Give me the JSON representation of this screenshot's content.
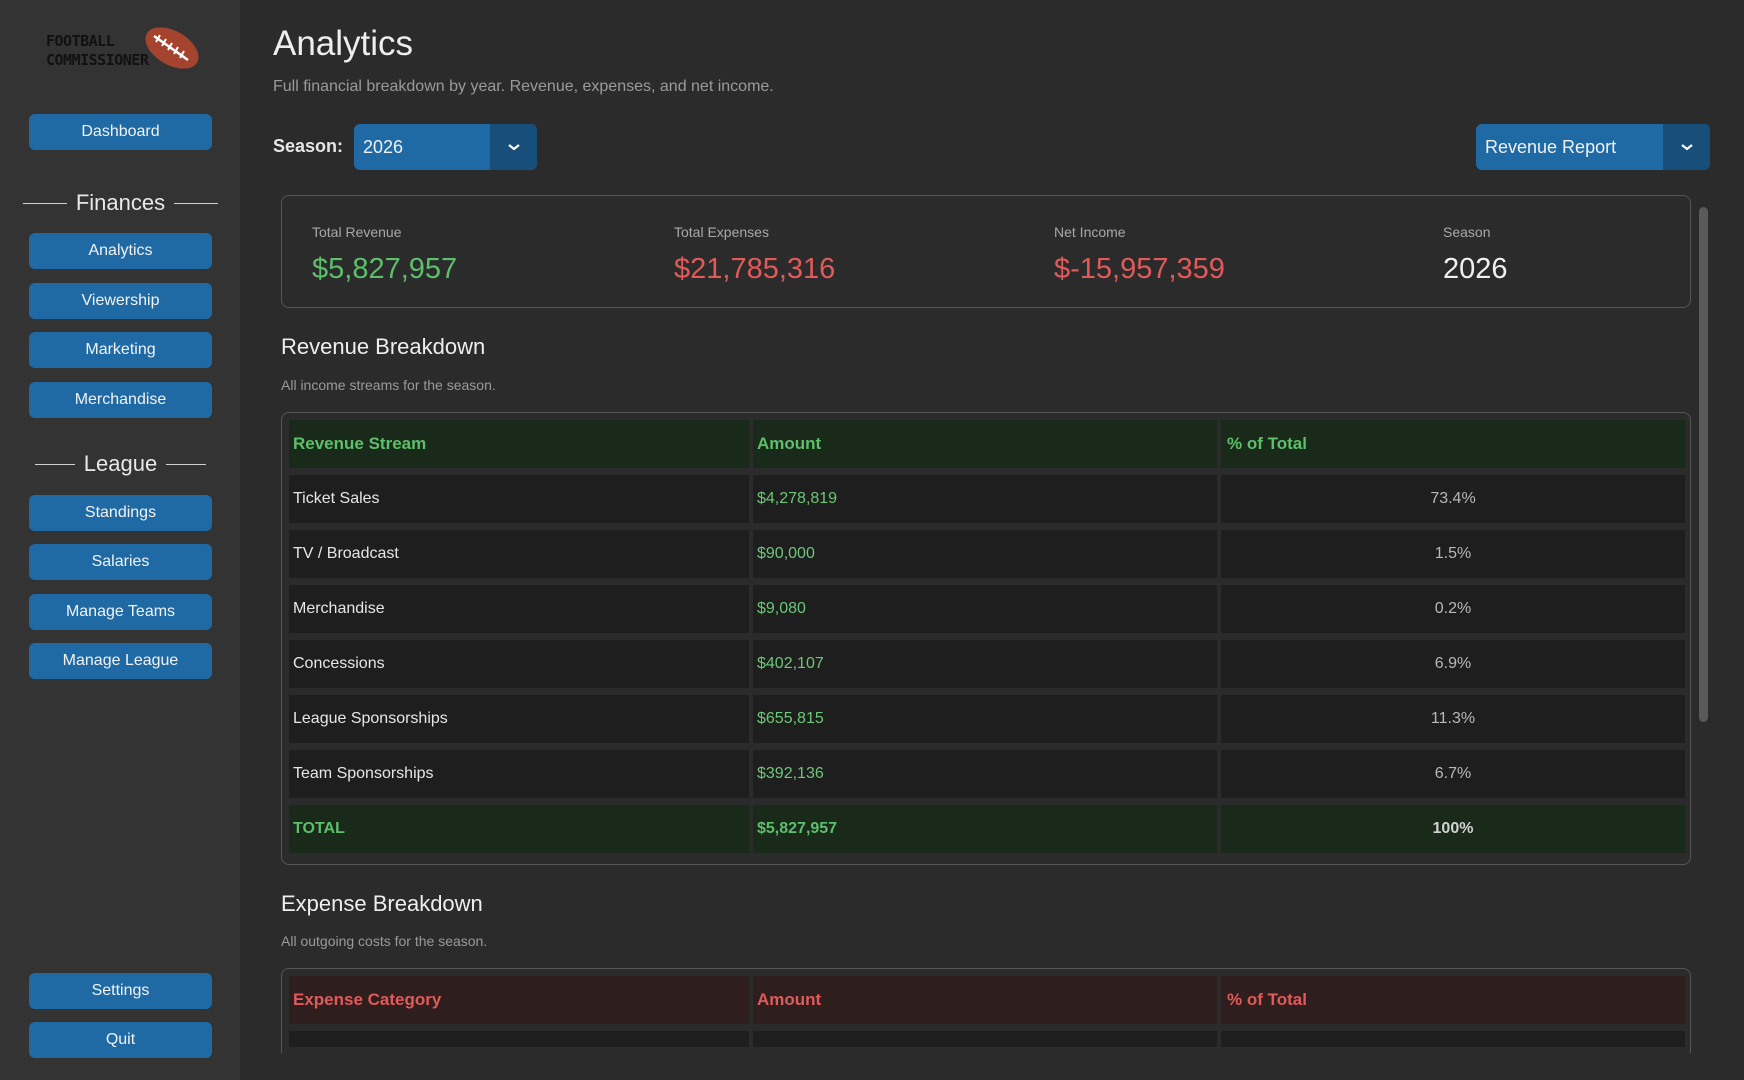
{
  "logo": {
    "line1": "FOOTBALL",
    "line2": "COMMISSIONER"
  },
  "nav": {
    "dashboard": "Dashboard",
    "finances_heading": "Finances",
    "analytics": "Analytics",
    "viewership": "Viewership",
    "marketing": "Marketing",
    "merchandise": "Merchandise",
    "league_heading": "League",
    "standings": "Standings",
    "salaries": "Salaries",
    "manage_teams": "Manage Teams",
    "manage_league": "Manage League",
    "settings": "Settings",
    "quit": "Quit"
  },
  "header": {
    "title": "Analytics",
    "subtitle": "Full financial breakdown by year. Revenue, expenses, and net income.",
    "season_label": "Season:",
    "season_value": "2026",
    "report_value": "Revenue Report"
  },
  "summary": {
    "total_revenue_label": "Total Revenue",
    "total_revenue": "$5,827,957",
    "total_expenses_label": "Total Expenses",
    "total_expenses": "$21,785,316",
    "net_income_label": "Net Income",
    "net_income": "$-15,957,359",
    "season_label": "Season",
    "season": "2026"
  },
  "revenue": {
    "title": "Revenue Breakdown",
    "subtitle": "All income streams for the season.",
    "headers": [
      "Revenue Stream",
      "Amount",
      "% of Total"
    ],
    "rows": [
      [
        "Ticket Sales",
        "$4,278,819",
        "73.4%"
      ],
      [
        "TV / Broadcast",
        "$90,000",
        "1.5%"
      ],
      [
        "Merchandise",
        "$9,080",
        "0.2%"
      ],
      [
        "Concessions",
        "$402,107",
        "6.9%"
      ],
      [
        "League Sponsorships",
        "$655,815",
        "11.3%"
      ],
      [
        "Team Sponsorships",
        "$392,136",
        "6.7%"
      ]
    ],
    "total": [
      "TOTAL",
      "$5,827,957",
      "100%"
    ]
  },
  "expense": {
    "title": "Expense Breakdown",
    "subtitle": "All outgoing costs for the season.",
    "headers": [
      "Expense Category",
      "Amount",
      "% of Total"
    ]
  },
  "colors": {
    "accent": "#1f6aa5",
    "positive": "#5cbf6a",
    "negative": "#e05a5a"
  }
}
